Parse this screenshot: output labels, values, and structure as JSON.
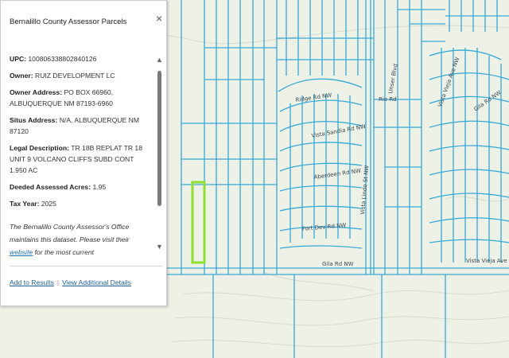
{
  "map": {
    "roads": [
      {
        "name": "Ridge Rd NW"
      },
      {
        "name": "Rio Rd"
      },
      {
        "name": "Gila Rd NW"
      },
      {
        "name": "Vista Vieja Ave NW"
      },
      {
        "name": "Unser Blvd"
      },
      {
        "name": "Vista Sandia Rd NW"
      },
      {
        "name": "Aberdeen Rd NW"
      },
      {
        "name": "Fort Dev Rd NW"
      },
      {
        "name": "Vista Vieja Ave NW"
      },
      {
        "name": "Vista Lindo St NW"
      },
      {
        "name": "Gila Rd NW"
      }
    ],
    "colors": {
      "background": "#eef1e6",
      "parcel_line": "#35a9d9",
      "selected_parcel": "#8ee02f",
      "contour": "#cfd8c3"
    }
  },
  "popup": {
    "title": "Bernalillo County Assessor Parcels",
    "close_icon": "×",
    "fields": [
      {
        "label": "UPC:",
        "value": "100806338802840126"
      },
      {
        "label": "Owner:",
        "value": "RUIZ DEVELOPMENT LC"
      },
      {
        "label": "Owner Address:",
        "value": "PO BOX 66960, ALBUQUERQUE NM 87193-6960"
      },
      {
        "label": "Situs Address:",
        "value": "N/A, ALBUQUERQUE NM 87120"
      },
      {
        "label": "Legal Description:",
        "value": "TR 18B REPLAT TR 18 UNIT 9 VOLCANO CLIFFS SUBD CONT 1.950 AC"
      },
      {
        "label": "Deeded Assessed Acres:",
        "value": "1.95"
      },
      {
        "label": "Tax Year:",
        "value": "2025"
      }
    ],
    "note_before": "The Bernalillo County Assessor's Office maintains this dataset. Please visit their ",
    "note_link": "website",
    "note_after": " for the most current",
    "scroll_up_icon": "▲",
    "scroll_down_icon": "▼",
    "actions": {
      "add_to_results": "Add to Results",
      "view_details": "View Additional Details"
    }
  }
}
